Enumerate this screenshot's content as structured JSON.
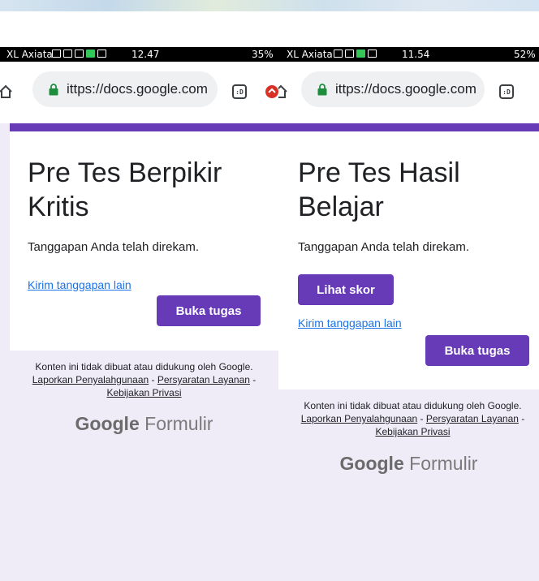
{
  "screenshots": [
    {
      "status_bar": {
        "carrier": "XL Axiata",
        "time": "12.47",
        "battery": "35%"
      },
      "browser": {
        "url": "ittps://docs.google.com",
        "tab_icon": ":D"
      },
      "form": {
        "title_line1": "Pre Tes Berpikir",
        "title_line2": "Kritis",
        "message": "Tanggapan Anda telah direkam.",
        "link": "Kirim tanggapan lain",
        "primary_button": "Buka tugas"
      },
      "footer": {
        "disclaimer": "Konten ini tidak dibuat atau didukung oleh Google.",
        "link_abuse": "Laporkan Penyalahgunaan",
        "link_terms": "Persyaratan Layanan",
        "link_privacy": "Kebijakan Privasi",
        "sep": " - ",
        "brand_google": "Google",
        "brand_forms": "Formulir"
      }
    },
    {
      "status_bar": {
        "carrier": "XL Axiata",
        "time": "11.54",
        "battery": "52%"
      },
      "browser": {
        "url": "ittps://docs.google.com",
        "tab_icon": ":D"
      },
      "form": {
        "title_line1": "Pre Tes Hasil",
        "title_line2": "Belajar",
        "message": "Tanggapan Anda telah direkam.",
        "score_button": "Lihat skor",
        "link": "Kirim tanggapan lain",
        "primary_button": "Buka tugas"
      },
      "footer": {
        "disclaimer": "Konten ini tidak dibuat atau didukung oleh Google.",
        "link_abuse": "Laporkan Penyalahgunaan",
        "link_terms": "Persyaratan Layanan",
        "link_privacy": "Kebijakan Privasi",
        "sep": " - ",
        "brand_google": "Google",
        "brand_forms": "Formulir"
      }
    }
  ],
  "colors": {
    "form_accent": "#673ab7",
    "form_background": "#efecf8",
    "link": "#1a73e8",
    "status_bar": "#000000"
  }
}
